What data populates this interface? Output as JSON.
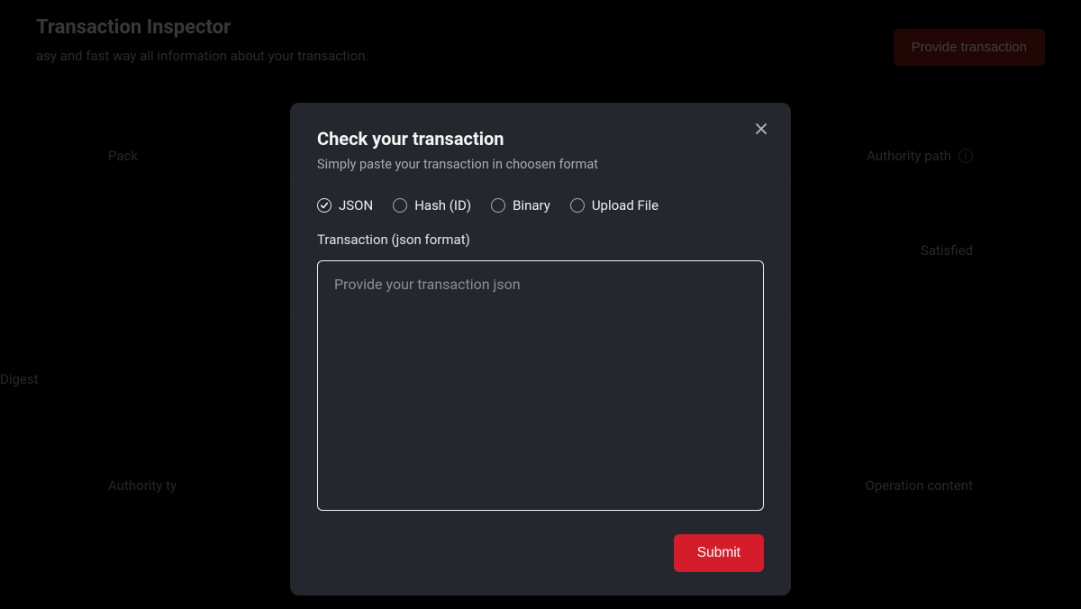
{
  "page": {
    "title": "Transaction Inspector",
    "subtitle": "asy and fast way all information about your transaction.",
    "provide_button": "Provide transaction",
    "tabs": {
      "pack": "Pack",
      "authority_path": "Authority path"
    },
    "rows": {
      "satisfied": "Satisfied",
      "digest": "Digest",
      "authority_type": "Authority ty",
      "operation_content": "Operation content"
    }
  },
  "modal": {
    "title": "Check your transaction",
    "subtitle": "Simply paste your transaction in choosen format",
    "radios": {
      "json": "JSON",
      "hash": "Hash (ID)",
      "binary": "Binary",
      "upload": "Upload File"
    },
    "field_label": "Transaction (json format)",
    "textarea_placeholder": "Provide your transaction json",
    "submit": "Submit"
  }
}
